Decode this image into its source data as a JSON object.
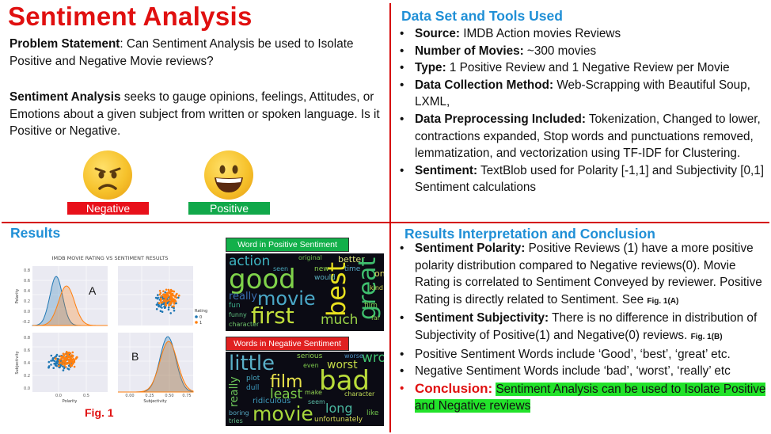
{
  "left": {
    "title": "Sentiment Analysis",
    "problem_label": "Problem Statement",
    "problem_text": ": Can Sentiment Analysis be used to Isolate Positive and Negative  Movie reviews?",
    "sa_label": "Sentiment Analysis",
    "sa_text": " seeks to gauge opinions, feelings, Attitudes, or Emotions about a given subject from written or spoken language. Is it Positive or Negative.",
    "negative_label": "Negative",
    "positive_label": "Positive",
    "negative_color": "#e8101a",
    "positive_color": "#11a84a"
  },
  "dataset": {
    "heading": "Data Set and Tools Used",
    "items": [
      {
        "label": "Source:",
        "text": " IMDB Action movies Reviews"
      },
      {
        "label": "Number of Movies:",
        "text": " ~300 movies"
      },
      {
        "label": "Type:",
        "text": " 1 Positive Review and 1 Negative Review per Movie"
      },
      {
        "label": "Data Collection Method:",
        "text": " Web-Scrapping with Beautiful Soup, LXML,"
      },
      {
        "label": "Data Preprocessing Included:",
        "text": " Tokenization, Changed to lower, contractions expanded, Stop words and punctuations removed, lemmatization, and vectorization using TF-IDF for Clustering."
      },
      {
        "label": "Sentiment:",
        "text": " TextBlob used for Polarity [-1,1] and Subjectivity [0,1] Sentiment calculations"
      }
    ]
  },
  "results": {
    "heading": "Results",
    "chart_title": "IMDB MOVIE RATING VS SENTIMENT RESULTS",
    "panel_a": "A",
    "panel_b": "B",
    "xlabel_polarity": "Polarity",
    "xlabel_subjectivity": "Subjectivity",
    "ylabel_polarity": "Polarity",
    "ylabel_subjectivity": "Subjectivity",
    "legend_title": "Rating",
    "legend_0": "0",
    "legend_1": "1",
    "ticks_pol_y": [
      "0.8",
      "0.6",
      "0.4",
      "0.2",
      "0.0",
      "-0.2"
    ],
    "ticks_subj_y": [
      "0.8",
      "0.6",
      "0.4",
      "0.2",
      "0.0"
    ],
    "ticks_pol_x": [
      "0.0",
      "0.5"
    ],
    "ticks_subj_x": [
      "0.00",
      "0.25",
      "0.50",
      "0.75"
    ],
    "fig_label": "Fig. 1",
    "color_neg": "#1f77b4",
    "color_pos": "#ff7f0e",
    "wc_pos_label": "Word in Positive Sentiment",
    "wc_neg_label": "Words in Negative Sentiment",
    "wc_pos_words": [
      "action",
      "original",
      "better",
      "good",
      "movie",
      "first",
      "best",
      "great",
      "much",
      "really",
      "fun",
      "new",
      "would",
      "kind",
      "character",
      "one",
      "time",
      "film",
      "seen",
      "far",
      "funny"
    ],
    "wc_neg_words": [
      "little",
      "bad",
      "film",
      "least",
      "worst",
      "wrong",
      "movie",
      "ridiculous",
      "long",
      "really",
      "boring",
      "serious",
      "worse",
      "unfortunately",
      "tries",
      "even",
      "plot",
      "make",
      "seem",
      "character",
      "dull",
      "like"
    ]
  },
  "conclusion": {
    "heading": "Results Interpretation and Conclusion",
    "items": [
      {
        "label": "Sentiment Polarity:",
        "text": " Positive Reviews (1) have a more positive polarity distribution compared to Negative reviews(0). Movie Rating is correlated to  Sentiment Conveyed by reviewer. Positive Rating is directly related to Sentiment. See ",
        "ref": "Fig. 1(A)"
      },
      {
        "label": "Sentiment Subjectivity:",
        "text": " There is no difference in distribution of Subjectivity of Positive(1) and Negative(0) reviews. ",
        "ref": "Fig. 1(B)"
      },
      {
        "text": "Positive Sentiment Words  include ‘Good’, ‘best’, ‘great’ etc."
      },
      {
        "text": "Negative Sentiment Words include ‘bad’, ‘worst’, ‘really’ etc"
      }
    ],
    "conclusion_label": "Conclusion:",
    "conclusion_text": "Sentiment Analysis can be used to Isolate Positive and Negative reviews",
    "highlight_color": "#22e22a"
  }
}
